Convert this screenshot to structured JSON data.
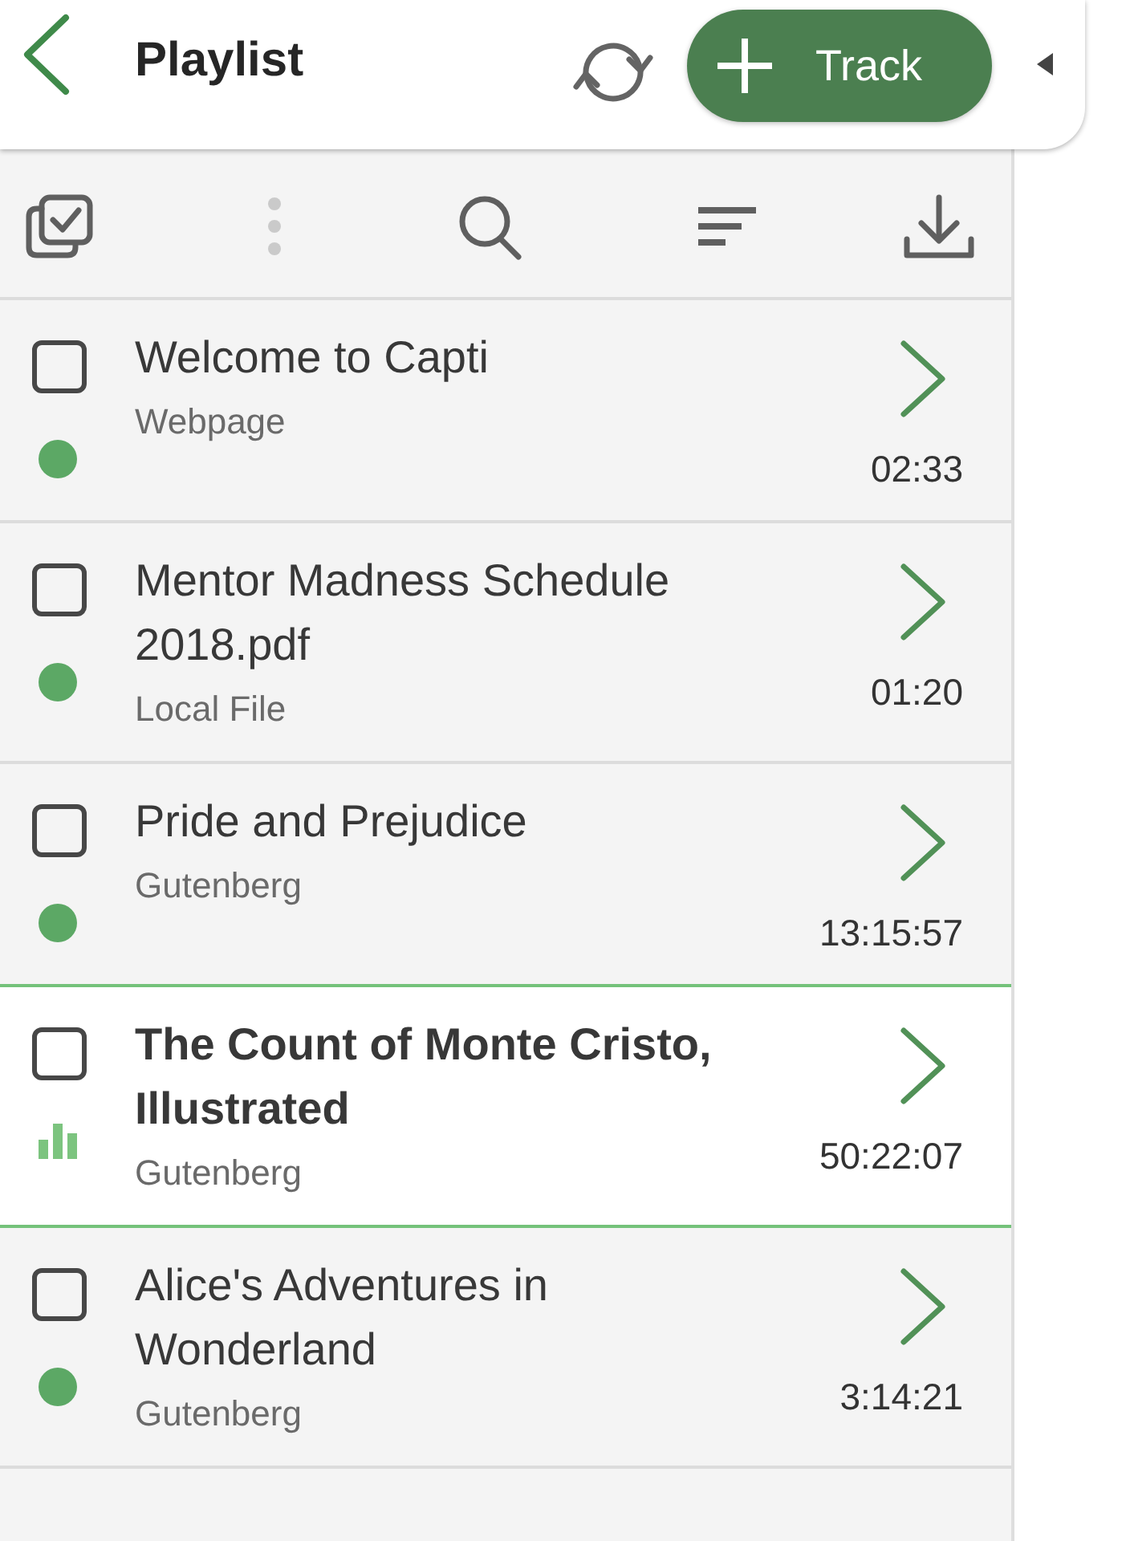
{
  "header": {
    "title": "Playlist",
    "add_button": {
      "label": "Track"
    }
  },
  "toolbar": [
    {
      "kind": "select_all",
      "disabled": false
    },
    {
      "kind": "more",
      "disabled": true
    },
    {
      "kind": "search",
      "disabled": false
    },
    {
      "kind": "sort",
      "disabled": false
    },
    {
      "kind": "download",
      "disabled": false
    }
  ],
  "tracks": [
    {
      "title": "Welcome to Capti",
      "source": "Webpage",
      "duration": "02:33",
      "checked": false,
      "playing": false,
      "selected": false
    },
    {
      "title": "Mentor Madness Schedule 2018.pdf",
      "source": "Local File",
      "duration": "01:20",
      "checked": false,
      "playing": false,
      "selected": false
    },
    {
      "title": "Pride and Prejudice",
      "source": "Gutenberg",
      "duration": "13:15:57",
      "checked": false,
      "playing": false,
      "selected": false
    },
    {
      "title": "The Count of Monte Cristo, Illustrated",
      "source": "Gutenberg",
      "duration": "50:22:07",
      "checked": false,
      "playing": true,
      "selected": true
    },
    {
      "title": "Alice's Adventures in Wonderland",
      "source": "Gutenberg",
      "duration": "3:14:21",
      "checked": false,
      "playing": false,
      "selected": false
    }
  ]
}
